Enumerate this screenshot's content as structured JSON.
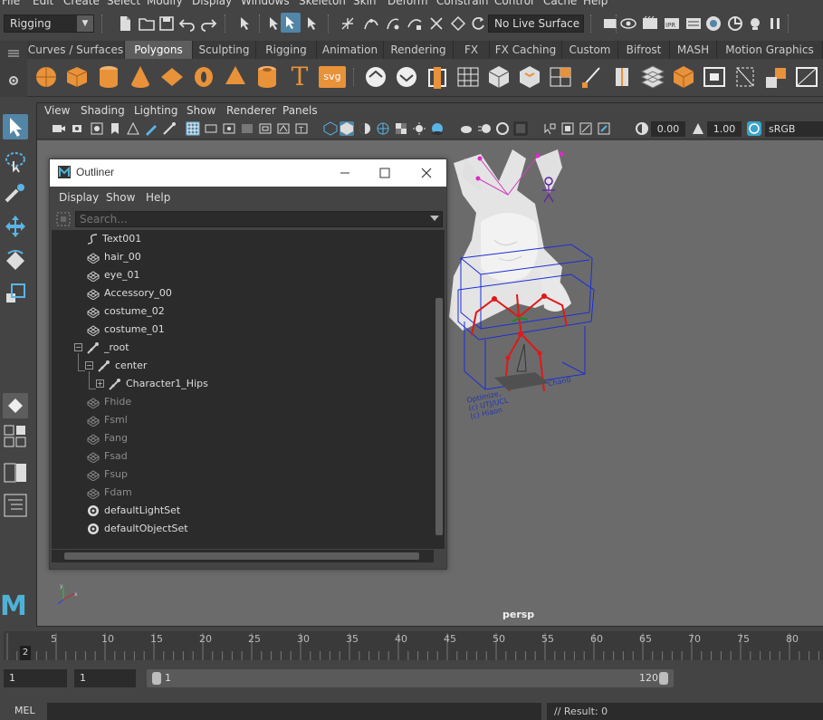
{
  "menubar": {
    "items": [
      "File",
      "Edit",
      "Create",
      "Select",
      "Modify",
      "Display",
      "Windows",
      "Skeleton",
      "Skin",
      "Deform",
      "Constrain",
      "Control",
      "Cache",
      "Help"
    ]
  },
  "statusline": {
    "mode_selector": "Rigging",
    "live_surface": "No Live Surface"
  },
  "shelf": {
    "tabs": [
      "Curves / Surfaces",
      "Polygons",
      "Sculpting",
      "Rigging",
      "Animation",
      "Rendering",
      "FX",
      "FX Caching",
      "Custom",
      "Bifrost",
      "MASH",
      "Motion Graphics"
    ],
    "active_tab": "Polygons",
    "svg_label": "svg",
    "text_label": "T"
  },
  "viewport": {
    "menus": [
      "View",
      "Shading",
      "Lighting",
      "Show",
      "Renderer",
      "Panels"
    ],
    "exposure": "0.00",
    "gamma": "1.00",
    "color_space": "sRGB gamma",
    "camera_label": "persp",
    "scene_text": [
      "Optimize,",
      "(c) UTJ/UCL",
      "(c) Hiaon",
      "Chan0"
    ]
  },
  "outliner": {
    "title": "Outliner",
    "menus": [
      "Display",
      "Show",
      "Help"
    ],
    "search_placeholder": "Search...",
    "items": [
      {
        "label": "Text001",
        "icon": "curve-icon",
        "dim": false
      },
      {
        "label": "hair_00",
        "icon": "mesh-icon",
        "dim": false
      },
      {
        "label": "eye_01",
        "icon": "mesh-icon",
        "dim": false
      },
      {
        "label": "Accessory_00",
        "icon": "mesh-icon",
        "dim": false
      },
      {
        "label": "costume_02",
        "icon": "mesh-icon",
        "dim": false
      },
      {
        "label": "costume_01",
        "icon": "mesh-icon",
        "dim": false
      },
      {
        "label": "_root",
        "icon": "joint-icon",
        "dim": false
      },
      {
        "label": "center",
        "icon": "joint-icon",
        "dim": false
      },
      {
        "label": "Character1_Hips",
        "icon": "joint-icon",
        "dim": false
      },
      {
        "label": "Fhide",
        "icon": "mesh-icon",
        "dim": true
      },
      {
        "label": "Fsml",
        "icon": "mesh-icon",
        "dim": true
      },
      {
        "label": "Fang",
        "icon": "mesh-icon",
        "dim": true
      },
      {
        "label": "Fsad",
        "icon": "mesh-icon",
        "dim": true
      },
      {
        "label": "Fsup",
        "icon": "mesh-icon",
        "dim": true
      },
      {
        "label": "Fdam",
        "icon": "mesh-icon",
        "dim": true
      },
      {
        "label": "defaultLightSet",
        "icon": "set-icon",
        "dim": false
      },
      {
        "label": "defaultObjectSet",
        "icon": "set-icon",
        "dim": false
      }
    ]
  },
  "timeslider": {
    "ticks": [
      "5",
      "10",
      "15",
      "20",
      "25",
      "30",
      "35",
      "40",
      "45",
      "50",
      "55",
      "60",
      "65",
      "70",
      "75",
      "80"
    ],
    "current_frame": "2"
  },
  "rangeslider": {
    "start": "1",
    "anim_start": "1",
    "range_start": "1",
    "range_end": "120"
  },
  "cmdline": {
    "label": "MEL",
    "result": "// Result: 0"
  },
  "colors": {
    "accent": "#5285a6",
    "viewport_bg": "#6b6b6b",
    "shelf_icon_orange": "#e8923a"
  }
}
